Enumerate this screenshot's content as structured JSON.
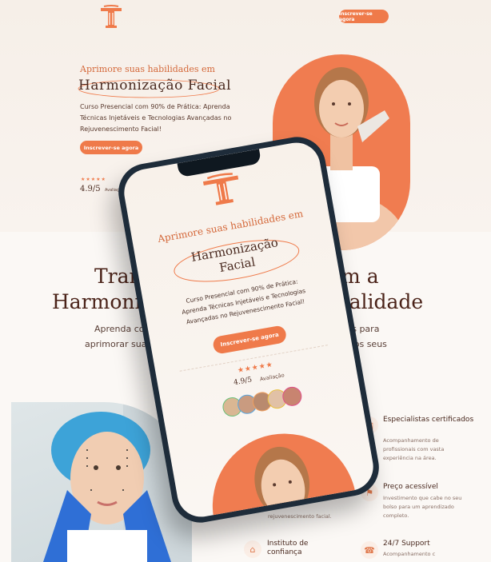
{
  "header": {
    "cta_label": "Inscrever-se agora"
  },
  "hero": {
    "kicker": "Aprimore suas habilidades em",
    "title": "Harmonização Facial",
    "description": "Curso Presencial com 90% de Prática: Aprenda Técnicas Injetáveis e Tecnologias Avançadas no Rejuvenescimento Facial!",
    "cta_label": "Inscrever-se agora",
    "stars": "★★★★★",
    "rating": "4.9/5",
    "rating_label": "Avaliação"
  },
  "section2": {
    "title_line1_left": "Transfo",
    "title_line1_right": "com a",
    "title_line2_left": "Harmonizaçã",
    "title_line2_right": "Qualidade",
    "sub_line1_left": "Aprenda com os",
    "sub_line1_right": "ançadas para",
    "sub_line2_left": "aprimorar suas habi",
    "sub_line2_right": "nais aos seus"
  },
  "features": [
    {
      "icon": "certificate-icon",
      "title": "Especialistas certificados",
      "description": "Acompanhamento de profissionais com vasta experiência na área."
    },
    {
      "icon": "price-tag-icon",
      "title": "Preço acessível",
      "description": "Investimento que cabe no seu bolso para um aprendizado completo."
    },
    {
      "icon": "support-icon",
      "title": "24/7 Support",
      "description": "Acompanhamento c"
    },
    {
      "icon": "trust-icon",
      "title": "Instituto de confiança",
      "description": ""
    }
  ],
  "partial_text": {
    "rejuvenescimento": "rejuvenescimento facial."
  },
  "phone": {
    "kicker": "Aprimore suas habilidades em",
    "title_line1": "Harmonização",
    "title_line2": "Facial",
    "desc_line1": "Curso Presencial com 90% de Prática:",
    "desc_line2": "Aprenda Técnicas Injetáveis e Tecnologias",
    "desc_line3": "Avançadas no Rejuvenescimento Facial!",
    "cta_label": "Inscrever-se agora",
    "stars": "★★★★★",
    "rating": "4.9/5",
    "rating_label": "Avaliação",
    "avatar_count": 5
  },
  "colors": {
    "accent": "#ef7a4a",
    "brown": "#4a2a20",
    "background": "#fbf8f5"
  }
}
